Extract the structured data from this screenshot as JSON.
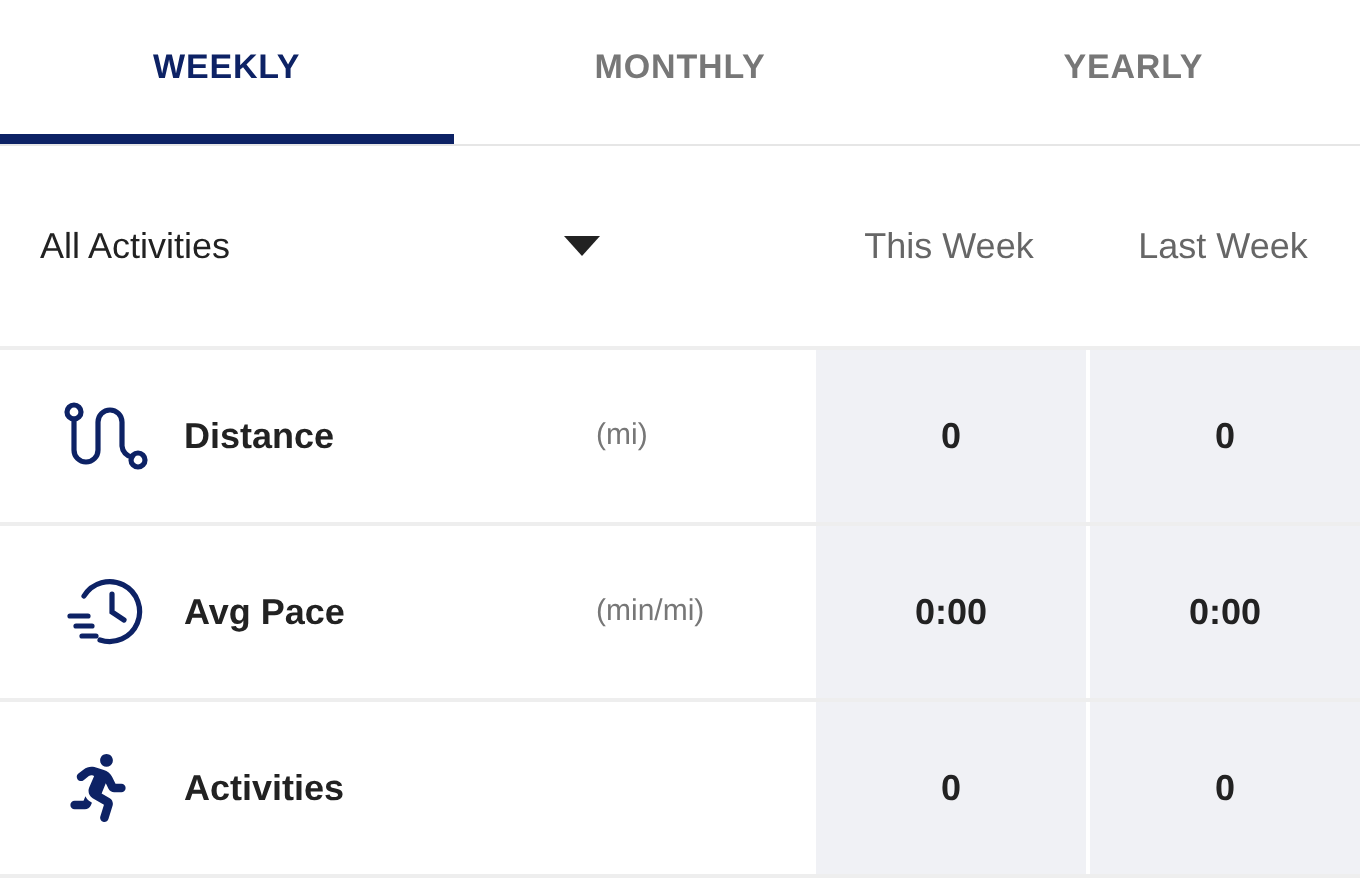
{
  "tabs": [
    {
      "label": "WEEKLY",
      "selected": true
    },
    {
      "label": "MONTHLY",
      "selected": false
    },
    {
      "label": "YEARLY",
      "selected": false
    }
  ],
  "filter": {
    "value": "All Activities"
  },
  "columns": [
    "This Week",
    "Last Week"
  ],
  "rows": [
    {
      "label": "Distance",
      "unit": "(mi)",
      "values": [
        "0",
        "0"
      ]
    },
    {
      "label": "Avg Pace",
      "unit": "(min/mi)",
      "values": [
        "0:00",
        "0:00"
      ]
    },
    {
      "label": "Activities",
      "unit": "",
      "values": [
        "0",
        "0"
      ]
    }
  ]
}
